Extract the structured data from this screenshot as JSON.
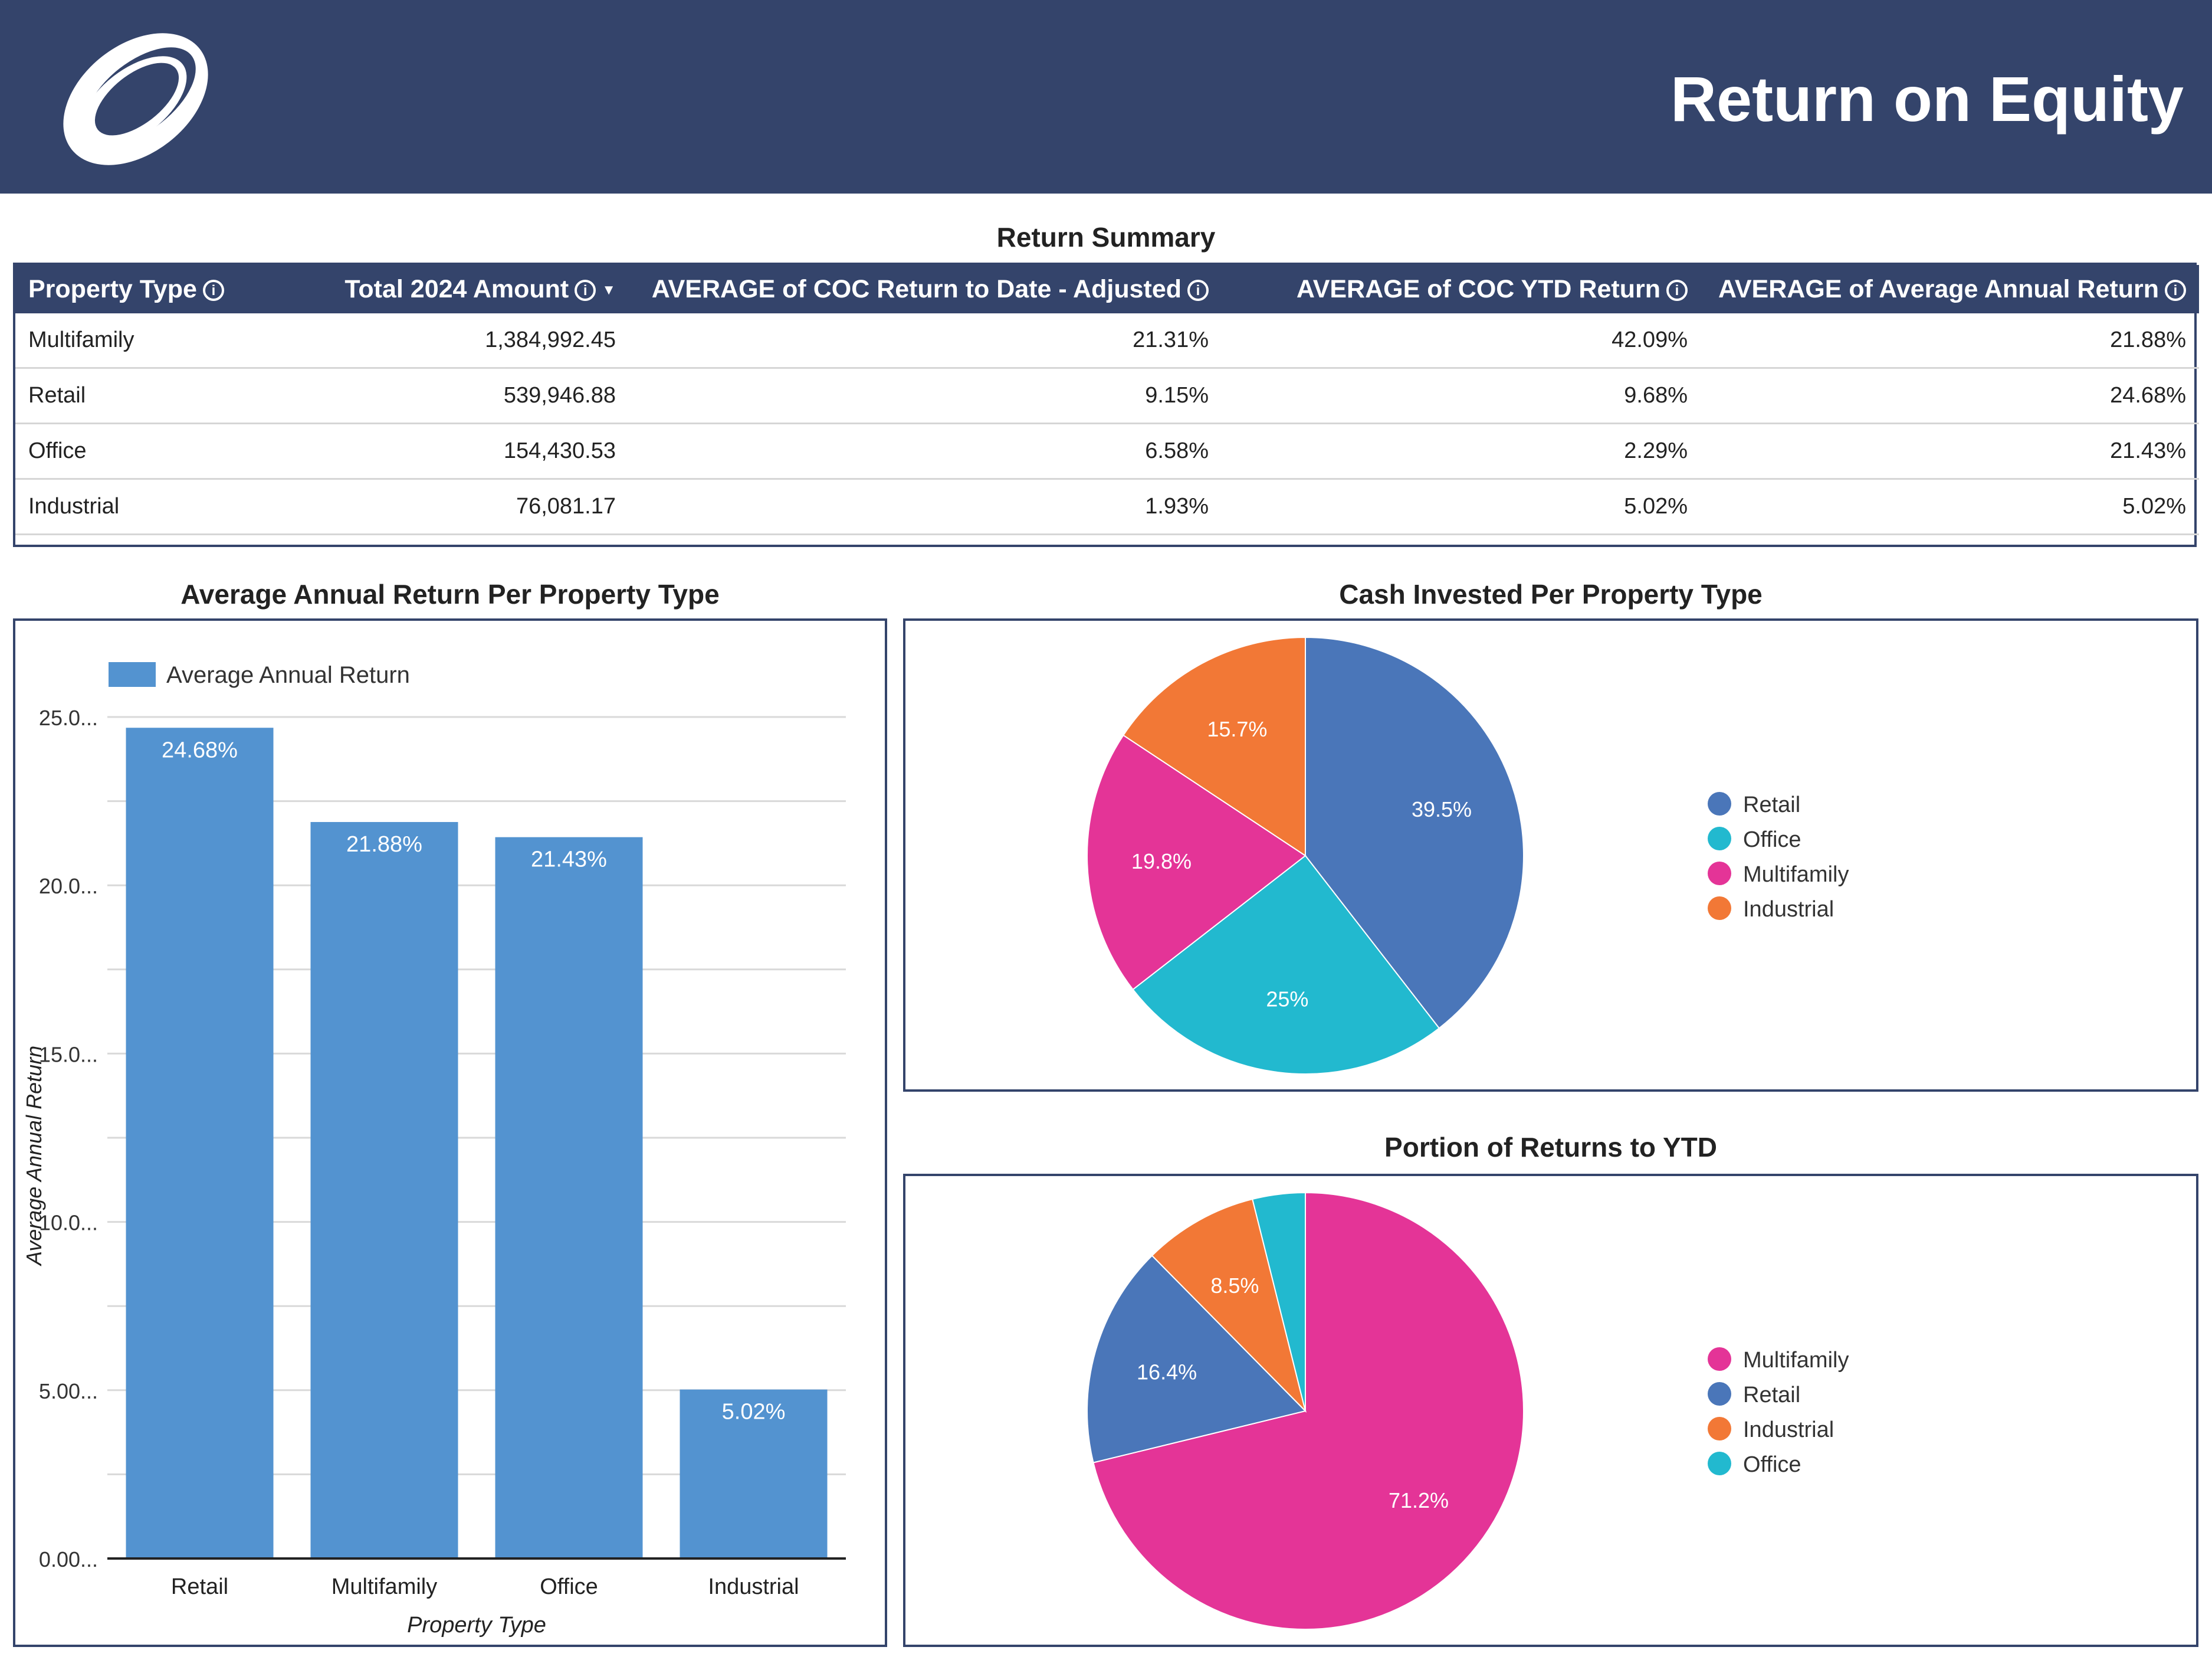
{
  "header": {
    "title": "Return on Equity"
  },
  "summary": {
    "title": "Return Summary",
    "columns": [
      "Property Type",
      "Total 2024 Amount",
      "AVERAGE of COC Return to Date - Adjusted",
      "AVERAGE of COC YTD Return",
      "AVERAGE of Average Annual Return"
    ],
    "rows": [
      [
        "Multifamily",
        "1,384,992.45",
        "21.31%",
        "42.09%",
        "21.88%"
      ],
      [
        "Retail",
        "539,946.88",
        "9.15%",
        "9.68%",
        "24.68%"
      ],
      [
        "Office",
        "154,430.53",
        "6.58%",
        "2.29%",
        "21.43%"
      ],
      [
        "Industrial",
        "76,081.17",
        "1.93%",
        "5.02%",
        "5.02%"
      ]
    ]
  },
  "chart_data": [
    {
      "type": "bar",
      "title": "Average Annual Return Per Property Type",
      "categories": [
        "Retail",
        "Multifamily",
        "Office",
        "Industrial"
      ],
      "series": [
        {
          "name": "Average Annual Return",
          "values": [
            24.68,
            21.88,
            21.43,
            5.02
          ],
          "color": "#5393d0"
        }
      ],
      "data_labels": [
        "24.68%",
        "21.88%",
        "21.43%",
        "5.02%"
      ],
      "xlabel": "Property Type",
      "ylabel": "Average Annual Return",
      "ylim": [
        0,
        25
      ],
      "yticks": [
        0,
        5,
        10,
        15,
        20,
        25
      ],
      "ytick_labels": [
        "0.00...",
        "5.00...",
        "10.0...",
        "15.0...",
        "20.0...",
        "25.0..."
      ],
      "grid": true,
      "legend": "top-left"
    },
    {
      "type": "pie",
      "title": "Cash Invested Per Property Type",
      "slices": [
        {
          "label": "Retail",
          "value": 39.5,
          "color": "#4a76b9",
          "text": "39.5%"
        },
        {
          "label": "Office",
          "value": 25,
          "color": "#22b9cf",
          "text": "25%"
        },
        {
          "label": "Multifamily",
          "value": 19.8,
          "color": "#e43497",
          "text": "19.8%"
        },
        {
          "label": "Industrial",
          "value": 15.7,
          "color": "#f27836",
          "text": "15.7%"
        }
      ],
      "legend": "right"
    },
    {
      "type": "pie",
      "title": "Portion of Returns to YTD",
      "slices": [
        {
          "label": "Multifamily",
          "value": 71.2,
          "color": "#e43497",
          "text": "71.2%"
        },
        {
          "label": "Retail",
          "value": 16.4,
          "color": "#4a76b9",
          "text": "16.4%"
        },
        {
          "label": "Industrial",
          "value": 8.5,
          "color": "#f27836",
          "text": "8.5%"
        },
        {
          "label": "Office",
          "value": 3.9,
          "color": "#22b9cf",
          "text": ""
        }
      ],
      "legend": "right"
    }
  ]
}
